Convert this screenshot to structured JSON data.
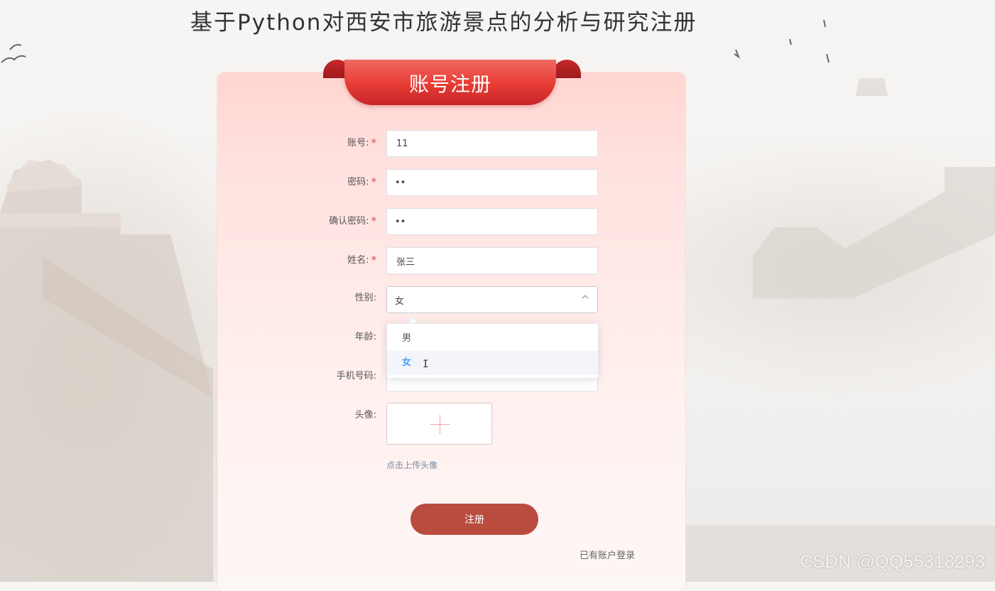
{
  "page_title": "基于Python对西安市旅游景点的分析与研究注册",
  "card": {
    "title": "账号注册"
  },
  "form": {
    "account": {
      "label": "账号:",
      "required": "*",
      "value": "11"
    },
    "password": {
      "label": "密码:",
      "required": "*",
      "value": "••"
    },
    "confirm_password": {
      "label": "确认密码:",
      "required": "*",
      "value": "••"
    },
    "name": {
      "label": "姓名:",
      "required": "*",
      "value": "张三"
    },
    "gender": {
      "label": "性别:",
      "value": "女",
      "options": [
        "男",
        "女"
      ],
      "selected": "女",
      "dropdown_open": true
    },
    "age": {
      "label": "年龄:"
    },
    "phone": {
      "label": "手机号码:"
    },
    "avatar": {
      "label": "头像:",
      "hint": "点击上传头像"
    }
  },
  "register_button": "注册",
  "login_link": "已有账户登录",
  "watermark": "CSDN @QQ55318293",
  "colors": {
    "ribbon": "#e63b33",
    "button": "#b94c3f",
    "selected_option": "#409eff",
    "required": "#e14a4a"
  },
  "icons": {
    "select_arrow": "chevron-up-icon",
    "upload": "plus-icon",
    "cursor": "text-cursor-icon"
  }
}
